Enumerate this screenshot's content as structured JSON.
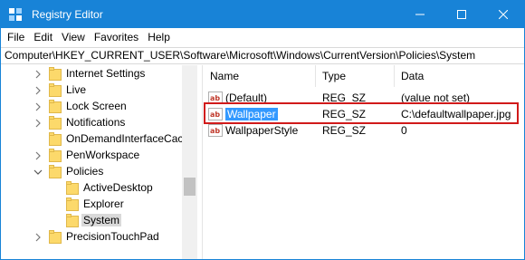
{
  "window": {
    "title": "Registry Editor",
    "accent_color": "#1883d7"
  },
  "menu": {
    "items": [
      "File",
      "Edit",
      "View",
      "Favorites",
      "Help"
    ]
  },
  "address": {
    "path": "Computer\\HKEY_CURRENT_USER\\Software\\Microsoft\\Windows\\CurrentVersion\\Policies\\System"
  },
  "tree": {
    "items": [
      {
        "label": "Internet Settings",
        "expanded": false,
        "has_children": true
      },
      {
        "label": "Live",
        "expanded": false,
        "has_children": true
      },
      {
        "label": "Lock Screen",
        "expanded": false,
        "has_children": true
      },
      {
        "label": "Notifications",
        "expanded": false,
        "has_children": true
      },
      {
        "label": "OnDemandInterfaceCac",
        "expanded": false,
        "has_children": false
      },
      {
        "label": "PenWorkspace",
        "expanded": false,
        "has_children": true
      },
      {
        "label": "Policies",
        "expanded": true,
        "has_children": true
      },
      {
        "label": "ActiveDesktop",
        "expanded": false,
        "has_children": false
      },
      {
        "label": "Explorer",
        "expanded": false,
        "has_children": false
      },
      {
        "label": "System",
        "expanded": false,
        "has_children": false,
        "selected": true
      },
      {
        "label": "PrecisionTouchPad",
        "expanded": false,
        "has_children": true
      }
    ]
  },
  "values_pane": {
    "columns": {
      "name": "Name",
      "type": "Type",
      "data": "Data"
    },
    "rows": [
      {
        "name": "(Default)",
        "type": "REG_SZ",
        "data": "(value not set)",
        "icon": "string-value-icon"
      },
      {
        "name": "Wallpaper",
        "type": "REG_SZ",
        "data": "C:\\defaultwallpaper.jpg",
        "icon": "string-value-icon",
        "selected": true
      },
      {
        "name": "WallpaperStyle",
        "type": "REG_SZ",
        "data": "0",
        "icon": "string-value-icon"
      }
    ],
    "selection_color": "#3399ff",
    "highlight_color": "#d11a1a"
  }
}
